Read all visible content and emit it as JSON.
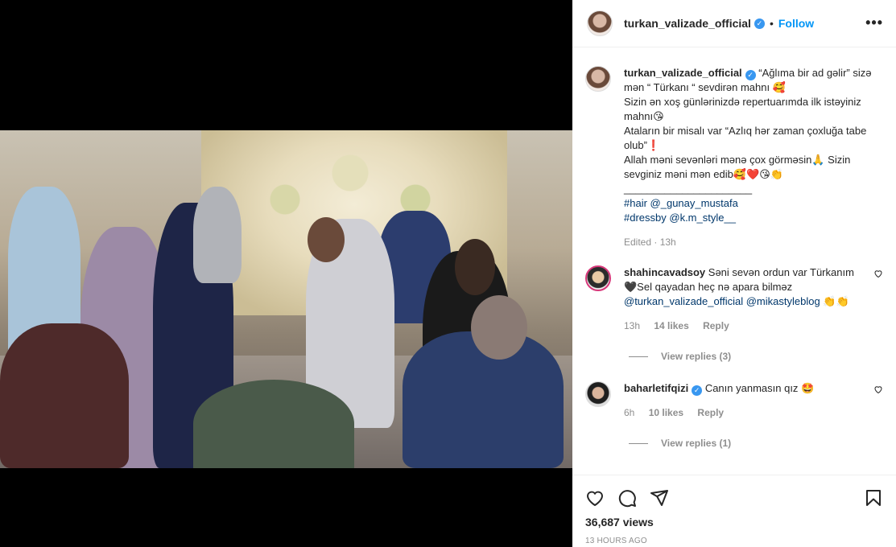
{
  "post": {
    "username": "turkan_valizade_official",
    "follow_label": "Follow",
    "more_label": "•••",
    "caption_lines": [
      "“Ağlıma bir ad gəlir” sizə",
      "mən “ Türkanı “ sevdirən mahnı 🥰",
      "Sizin ən xoş günlərinizdə repertuarımda ilk istəyiniz",
      "mahnı😘",
      "Ataların bir misalı var “Azlıq hər zaman çoxluğa tabe",
      "olub”❗️",
      "Allah məni sevənləri mənə çox görməsin🙏 Sizin",
      "sevginiz məni mən edib🥰❤️😘👏",
      "______________________"
    ],
    "tags": [
      [
        "#hair",
        "@_gunay_mustafa"
      ],
      [
        "#dressby",
        "@k.m_style__"
      ]
    ],
    "edited": "Edited · 13h",
    "views": "36,687 views",
    "ago": "13 HOURS AGO"
  },
  "comments": [
    {
      "username": "shahincavadsoy",
      "verified": false,
      "text_lines": [
        "Səni sevən ordun var Türkanım",
        "🖤Sel qayadan heç nə apara bilməz"
      ],
      "mentions": [
        "@turkan_valizade_official",
        "@mikastyleblog",
        "👏👏"
      ],
      "time": "13h",
      "likes": "14 likes",
      "reply": "Reply",
      "view_replies": "View replies (3)"
    },
    {
      "username": "baharletifqizi",
      "verified": true,
      "text": "Canın yanmasın qız 🤩",
      "time": "6h",
      "likes": "10 likes",
      "reply": "Reply",
      "view_replies": "View replies (1)"
    }
  ],
  "icons": [
    "heart-icon",
    "comment-icon",
    "share-icon",
    "bookmark-icon",
    "verified-icon",
    "more-icon"
  ],
  "colors": {
    "link": "#0095f6",
    "tag": "#00376b",
    "muted": "#8e8e8e",
    "verified": "#3897f0"
  }
}
